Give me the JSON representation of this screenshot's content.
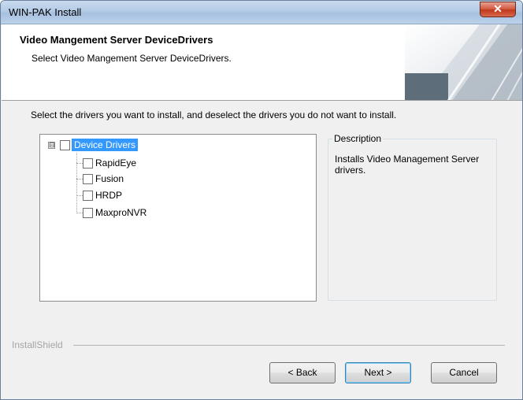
{
  "window": {
    "title": "WIN-PAK Install",
    "close_glyph": "✕"
  },
  "header": {
    "title": "Video Mangement Server DeviceDrivers",
    "subtitle": "Select Video Mangement Server DeviceDrivers."
  },
  "instruction": "Select the drivers you want to install, and deselect the drivers you do not want to install.",
  "tree": {
    "root": {
      "label": "Device Drivers",
      "checked": false,
      "selected": true,
      "expander": "⊟"
    },
    "children": [
      {
        "label": "RapidEye",
        "checked": false
      },
      {
        "label": "Fusion",
        "checked": false
      },
      {
        "label": "HRDP",
        "checked": false
      },
      {
        "label": "MaxproNVR",
        "checked": false
      }
    ]
  },
  "description": {
    "title": "Description",
    "text": "Installs Video Management Server drivers."
  },
  "brand": "InstallShield",
  "buttons": {
    "back": "< Back",
    "next": "Next >",
    "cancel": "Cancel"
  },
  "colors": {
    "selection": "#3399ff",
    "titlebar": "#b4cbe6",
    "close": "#c1381b"
  }
}
